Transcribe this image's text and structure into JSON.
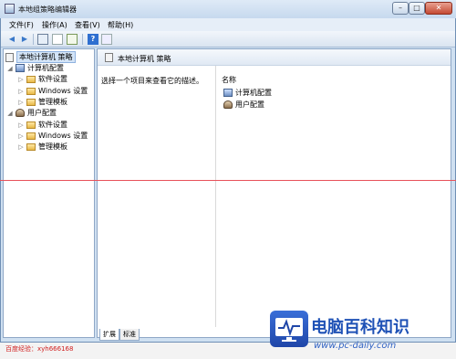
{
  "window": {
    "title": "本地组策略编辑器",
    "controls": {
      "minimize": "–",
      "maximize": "□",
      "close": "✕"
    }
  },
  "menubar": {
    "items": [
      "文件(F)",
      "操作(A)",
      "查看(V)",
      "帮助(H)"
    ]
  },
  "toolbar": {
    "icons": [
      "back-icon",
      "forward-icon",
      "show-tree-icon",
      "properties-icon",
      "export-icon",
      "help-icon",
      "view-icon"
    ]
  },
  "tree": {
    "root": "本地计算机 策略",
    "nodes": [
      {
        "label": "计算机配置",
        "level": 1,
        "icon": "computer-icon",
        "expanded": true
      },
      {
        "label": "软件设置",
        "level": 2,
        "icon": "folder-icon"
      },
      {
        "label": "Windows 设置",
        "level": 2,
        "icon": "folder-icon"
      },
      {
        "label": "管理模板",
        "level": 2,
        "icon": "folder-icon"
      },
      {
        "label": "用户配置",
        "level": 1,
        "icon": "user-icon",
        "expanded": true
      },
      {
        "label": "软件设置",
        "level": 2,
        "icon": "folder-icon"
      },
      {
        "label": "Windows 设置",
        "level": 2,
        "icon": "folder-icon"
      },
      {
        "label": "管理模板",
        "level": 2,
        "icon": "folder-icon"
      }
    ]
  },
  "right_pane": {
    "title": "本地计算机 策略",
    "description": "选择一个项目来查看它的描述。",
    "column_header": "名称",
    "items": [
      {
        "label": "计算机配置",
        "icon": "computer-icon"
      },
      {
        "label": "用户配置",
        "icon": "user-icon"
      }
    ],
    "tabs": [
      "扩展",
      "标准"
    ]
  },
  "status_bar": {
    "text": "百度经验：xyh666168"
  },
  "watermark": {
    "brand": "电脑百科知识",
    "url": "www.pc-daily.com"
  },
  "colors": {
    "accent": "#1f52b6",
    "divider": "#e8525a",
    "status_text": "#d01f1f"
  }
}
